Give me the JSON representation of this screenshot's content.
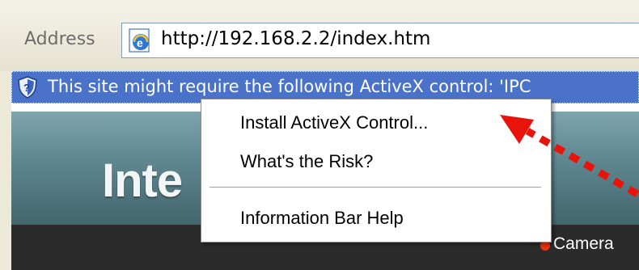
{
  "address_bar": {
    "label": "Address",
    "url": "http://192.168.2.2/index.htm",
    "icon": "ie-page-icon"
  },
  "info_bar": {
    "text": "This site might require the following ActiveX control: 'IPC",
    "icon": "shield-question-icon",
    "background": "#4a72c8"
  },
  "page": {
    "banner_title": "Inte",
    "camera_link": "Camera"
  },
  "context_menu": {
    "items": [
      {
        "label": "Install ActiveX Control..."
      },
      {
        "label": "What's the Risk?"
      },
      {
        "label": "Information Bar Help"
      }
    ]
  },
  "annotation": {
    "arrow_color": "#e8140c"
  }
}
